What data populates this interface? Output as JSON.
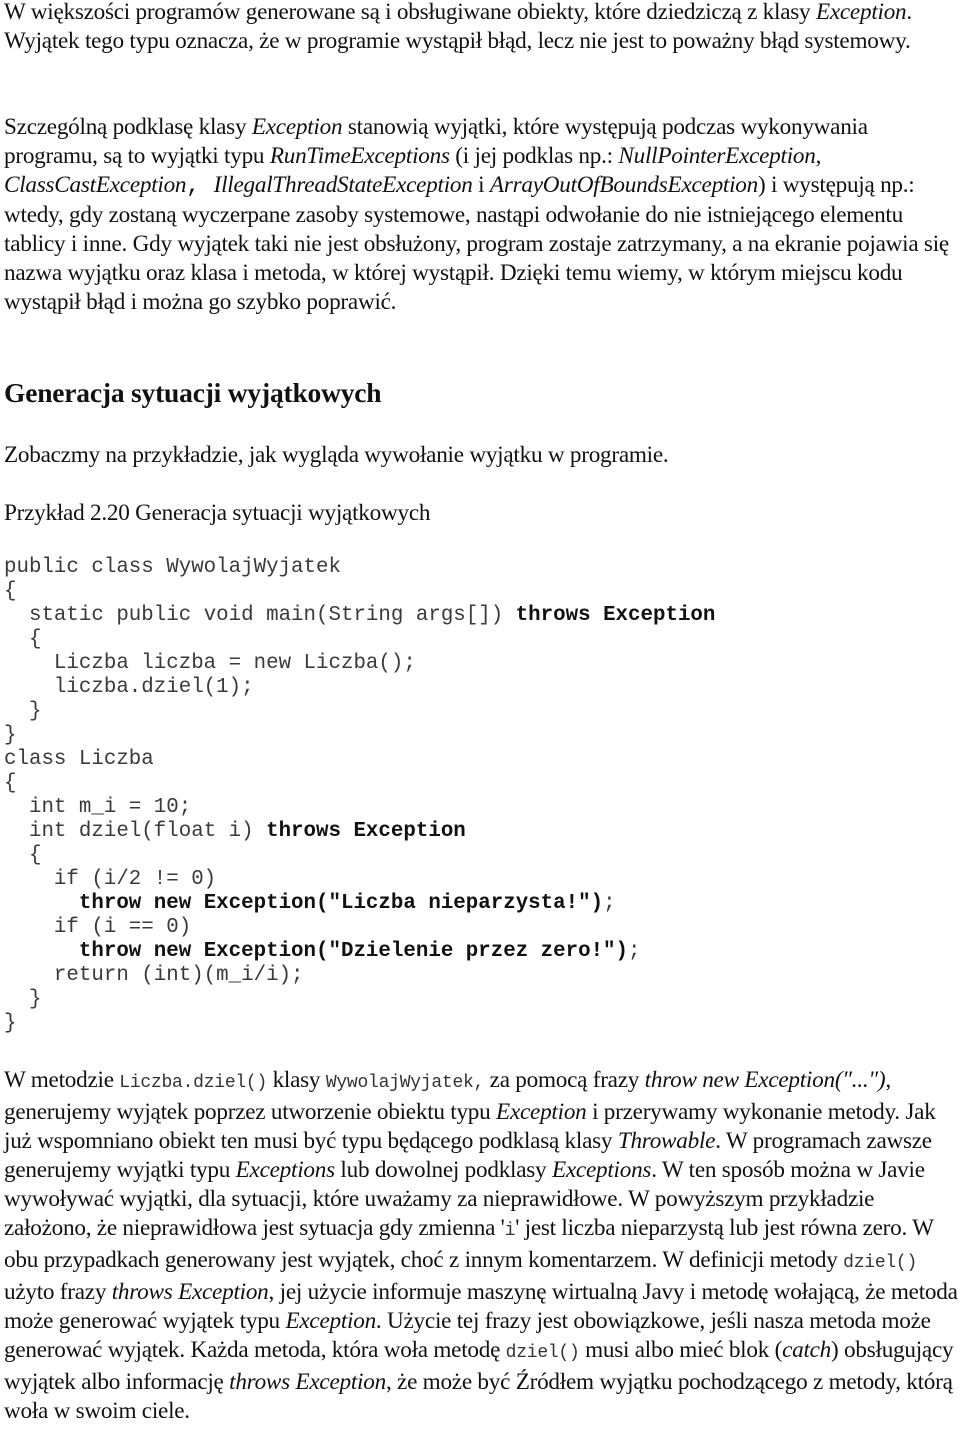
{
  "paragraph1": {
    "segments": [
      {
        "text": "W większości programów generowane są i obsługiwane obiekty, które dziedziczą z klasy ",
        "style": "normal"
      },
      {
        "text": "Exception",
        "style": "italic"
      },
      {
        "text": ". Wyjątek tego typu oznacza, że w programie wystąpił błąd, lecz nie jest to poważny błąd systemowy.",
        "style": "normal"
      }
    ]
  },
  "paragraph2": {
    "segments": [
      {
        "text": "Szczególną podklasę klasy ",
        "style": "normal"
      },
      {
        "text": "Exception",
        "style": "italic"
      },
      {
        "text": " stanowią wyjątki, które występują podczas wykonywania programu, są to wyjątki typu ",
        "style": "normal"
      },
      {
        "text": "RunTimeExceptions",
        "style": "italic"
      },
      {
        "text": " (i jej podklas np.: ",
        "style": "normal"
      },
      {
        "text": "NullPointerException",
        "style": "italic"
      },
      {
        "text": ", ",
        "style": "normal"
      },
      {
        "text": "ClassCastException",
        "style": "italic"
      },
      {
        "text": ", ",
        "style": "mono"
      },
      {
        "text": "IllegalThreadStateException",
        "style": "italic"
      },
      {
        "text": " i ",
        "style": "normal"
      },
      {
        "text": "ArrayOutOfBoundsException",
        "style": "italic"
      },
      {
        "text": ") i występują np.: wtedy, gdy zostaną wyczerpane zasoby systemowe, nastąpi odwołanie do nie istniejącego elementu tablicy i inne. Gdy wyjątek taki nie jest obsłużony, program zostaje zatrzymany, a na ekranie pojawia się nazwa wyjątku oraz klasa i metoda, w której wystąpił. Dzięki temu wiemy, w którym miejscu kodu wystąpił błąd i można go szybko poprawić.",
        "style": "normal"
      }
    ]
  },
  "section": {
    "heading": "Generacja sytuacji wyjątkowych",
    "intro": "Zobaczmy na przykładzie, jak wygląda wywołanie wyjątku w programie.",
    "example_caption": "Przykład 2.20 Generacja sytuacji wyjątkowych"
  },
  "code": {
    "language": "java",
    "lines": [
      {
        "indent": 0,
        "parts": [
          {
            "text": "public class WywolajWyjatek",
            "bold": false
          }
        ]
      },
      {
        "indent": 0,
        "parts": [
          {
            "text": "{",
            "bold": false
          }
        ]
      },
      {
        "indent": 1,
        "parts": [
          {
            "text": "static public void main(String args[]) ",
            "bold": false
          },
          {
            "text": "throws Exception",
            "bold": true
          }
        ]
      },
      {
        "indent": 1,
        "parts": [
          {
            "text": "{",
            "bold": false
          }
        ]
      },
      {
        "indent": 2,
        "parts": [
          {
            "text": "Liczba liczba = new Liczba();",
            "bold": false
          }
        ]
      },
      {
        "indent": 2,
        "parts": [
          {
            "text": "liczba.dziel(1);",
            "bold": false
          }
        ]
      },
      {
        "indent": 1,
        "parts": [
          {
            "text": "}",
            "bold": false
          }
        ]
      },
      {
        "indent": 0,
        "parts": [
          {
            "text": "}",
            "bold": false
          }
        ]
      },
      {
        "indent": 0,
        "parts": [
          {
            "text": "class Liczba",
            "bold": false
          }
        ]
      },
      {
        "indent": 0,
        "parts": [
          {
            "text": "{",
            "bold": false
          }
        ]
      },
      {
        "indent": 1,
        "parts": [
          {
            "text": "int m_i = 10;",
            "bold": false
          }
        ]
      },
      {
        "indent": 1,
        "parts": [
          {
            "text": "int dziel(float i) ",
            "bold": false
          },
          {
            "text": "throws Exception",
            "bold": true
          }
        ]
      },
      {
        "indent": 1,
        "parts": [
          {
            "text": "{",
            "bold": false
          }
        ]
      },
      {
        "indent": 2,
        "parts": [
          {
            "text": "if (i/2 != 0)",
            "bold": false
          }
        ]
      },
      {
        "indent": 3,
        "parts": [
          {
            "text": "throw new Exception(\"Liczba nieparzysta!\")",
            "bold": true
          },
          {
            "text": ";",
            "bold": false
          }
        ]
      },
      {
        "indent": 2,
        "parts": [
          {
            "text": "if (i == 0)",
            "bold": false
          }
        ]
      },
      {
        "indent": 3,
        "parts": [
          {
            "text": "throw new Exception(\"Dzielenie przez zero!\")",
            "bold": true
          },
          {
            "text": ";",
            "bold": false
          }
        ]
      },
      {
        "indent": 2,
        "parts": [
          {
            "text": "return (int)(m_i/i);",
            "bold": false
          }
        ]
      },
      {
        "indent": 1,
        "parts": [
          {
            "text": "}",
            "bold": false
          }
        ]
      },
      {
        "indent": 0,
        "parts": [
          {
            "text": "}",
            "bold": false
          }
        ]
      }
    ]
  },
  "paragraph3": {
    "segments": [
      {
        "text": "W metodzie ",
        "style": "normal"
      },
      {
        "text": "Liczba.dziel()",
        "style": "code"
      },
      {
        "text": " klasy ",
        "style": "normal"
      },
      {
        "text": "WywolajWyjatek,",
        "style": "code"
      },
      {
        "text": " za pomocą frazy ",
        "style": "normal"
      },
      {
        "text": "throw new Exception(\"...\")",
        "style": "italic"
      },
      {
        "text": ", generujemy wyjątek poprzez utworzenie obiektu typu ",
        "style": "normal"
      },
      {
        "text": "Exception",
        "style": "italic"
      },
      {
        "text": " i przerywamy wykonanie metody. Jak już wspomniano obiekt ten musi być typu będącego podklasą klasy ",
        "style": "normal"
      },
      {
        "text": "Throwable",
        "style": "italic"
      },
      {
        "text": ". W programach zawsze generujemy wyjątki typu ",
        "style": "normal"
      },
      {
        "text": "Exceptions",
        "style": "italic"
      },
      {
        "text": " lub dowolnej podklasy ",
        "style": "normal"
      },
      {
        "text": "Exceptions",
        "style": "italic"
      },
      {
        "text": ". W ten sposób można w Javie wywoływać wyjątki, dla sytuacji, które uważamy za nieprawidłowe. W powyższym przykładzie założono, że nieprawidłowa jest sytuacja gdy zmienna '",
        "style": "normal"
      },
      {
        "text": "i",
        "style": "code"
      },
      {
        "text": "' jest liczba nieparzystą lub jest równa zero. W obu przypadkach generowany jest wyjątek, choć z innym komentarzem. W definicji metody ",
        "style": "normal"
      },
      {
        "text": "dziel()",
        "style": "code"
      },
      {
        "text": " użyto frazy ",
        "style": "normal"
      },
      {
        "text": "throws Exception",
        "style": "italic"
      },
      {
        "text": ", jej użycie informuje maszynę wirtualną Javy i metodę wołającą, że metoda może generować wyjątek typu ",
        "style": "normal"
      },
      {
        "text": "Exception",
        "style": "italic"
      },
      {
        "text": ". Użycie tej frazy jest obowiązkowe, jeśli nasza metoda może generować wyjątek. Każda metoda, która woła metodę ",
        "style": "normal"
      },
      {
        "text": "dziel()",
        "style": "code"
      },
      {
        "text": " musi albo mieć blok (",
        "style": "normal"
      },
      {
        "text": "catch",
        "style": "italic"
      },
      {
        "text": ") obsługujący wyjątek albo informację ",
        "style": "normal"
      },
      {
        "text": "throws Exception",
        "style": "italic"
      },
      {
        "text": ", że może być Źródłem wyjątku pochodzącego z metody, którą woła w swoim ciele.",
        "style": "normal"
      }
    ]
  }
}
